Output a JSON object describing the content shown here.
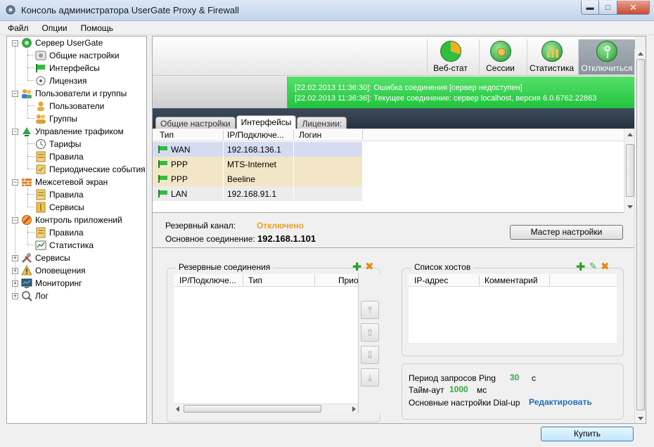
{
  "window": {
    "title": "Консоль администратора UserGate Proxy & Firewall"
  },
  "menu": [
    "Файл",
    "Опции",
    "Помощь"
  ],
  "tree": {
    "nodes": [
      {
        "label": "Сервер UserGate",
        "icon": "server-icon"
      },
      {
        "label": "Общие настройки",
        "icon": "settings-icon"
      },
      {
        "label": "Интерфейсы",
        "icon": "network-flag-icon"
      },
      {
        "label": "Лицензия",
        "icon": "license-icon"
      },
      {
        "label": "Пользователи и группы",
        "icon": "users-groups-icon"
      },
      {
        "label": "Пользователи",
        "icon": "user-icon"
      },
      {
        "label": "Группы",
        "icon": "group-icon"
      },
      {
        "label": "Управление трафиком",
        "icon": "traffic-icon"
      },
      {
        "label": "Тарифы",
        "icon": "tariff-icon"
      },
      {
        "label": "Правила",
        "icon": "rules-icon"
      },
      {
        "label": "Периодические события",
        "icon": "events-icon"
      },
      {
        "label": "Межсетевой экран",
        "icon": "firewall-icon"
      },
      {
        "label": "Правила",
        "icon": "rules-icon"
      },
      {
        "label": "Сервисы",
        "icon": "services-icon"
      },
      {
        "label": "Контроль приложений",
        "icon": "app-control-icon"
      },
      {
        "label": "Правила",
        "icon": "rules-icon"
      },
      {
        "label": "Статистика",
        "icon": "stats-icon"
      },
      {
        "label": "Сервисы",
        "icon": "tools-icon"
      },
      {
        "label": "Оповещения",
        "icon": "alert-icon"
      },
      {
        "label": "Мониторинг",
        "icon": "monitor-icon"
      },
      {
        "label": "Лог",
        "icon": "log-icon"
      }
    ]
  },
  "toolbar": {
    "webstat": "Веб-стат",
    "sessions": "Сессии",
    "statistics": "Статистика",
    "disconnect": "Отключиться"
  },
  "status": {
    "log": [
      "[22.02.2013 11:36:30]: Ошибка соединения [сервер недоступен]",
      "[22.02.2013 11:36:36]: Текущее соединение: сервер localhost, версия 6.0.6762.22863"
    ]
  },
  "tabs": [
    "Общие настройки",
    "Интерфейсы",
    "Лицензии:"
  ],
  "interfaces": {
    "columns": [
      "Тип",
      "IP/Подключе...",
      "Логин"
    ],
    "rows": [
      {
        "type": "WAN",
        "ip": "192.168.136.1",
        "login": ""
      },
      {
        "type": "PPP",
        "ip": "MTS-Internet",
        "login": ""
      },
      {
        "type": "PPP",
        "ip": "Beeline",
        "login": ""
      },
      {
        "type": "LAN",
        "ip": "192.168.91.1",
        "login": ""
      }
    ]
  },
  "info": {
    "backup_label": "Резервный канал:",
    "backup_value": "Отключено",
    "main_label": "Основное соединение:",
    "main_value": "192.168.1.101",
    "wizard_button": "Мастер настройки"
  },
  "backup_connections": {
    "title": "Резервные соединения",
    "columns": [
      "IP/Подключе...",
      "Тип",
      "Прио"
    ]
  },
  "hosts": {
    "title": "Список хостов",
    "columns": [
      "IP-адрес",
      "Комментарий"
    ]
  },
  "ping": {
    "period_label": "Период запросов Ping",
    "period_value": "30",
    "period_unit": "с",
    "timeout_label": "Тайм-аут",
    "timeout_value": "1000",
    "timeout_unit": "мс",
    "dialup_label": "Основные настройки Dial-up",
    "dialup_link": "Редактировать"
  },
  "footer": {
    "buy_button": "Купить"
  }
}
